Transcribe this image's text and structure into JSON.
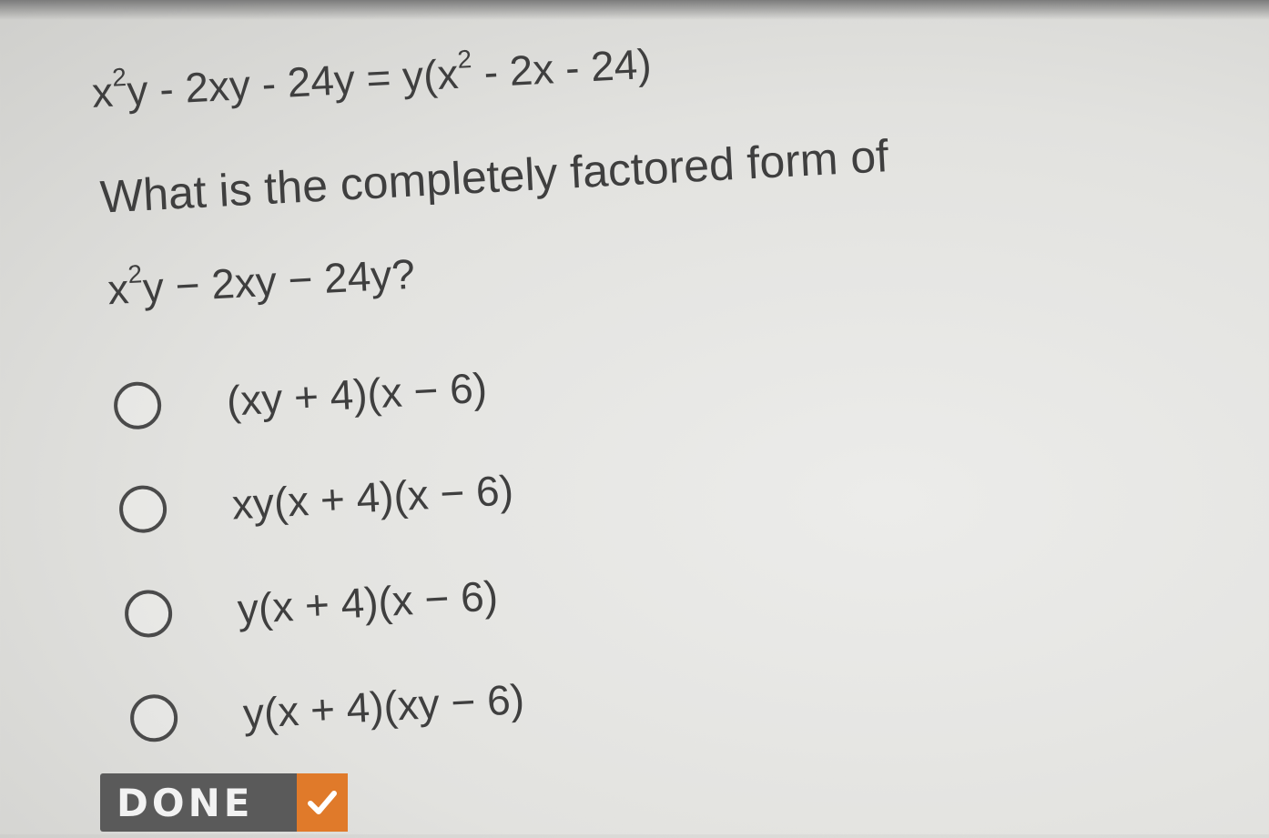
{
  "prompt_equation": {
    "parts": [
      "x",
      "2",
      "y - 2xy - 24y = y(x",
      "2",
      " - 2x - 24)"
    ]
  },
  "question": {
    "text": "What is the completely factored form of",
    "expression_parts": [
      "x",
      "2",
      "y − 2xy − 24y?"
    ]
  },
  "choices": [
    {
      "label": "(xy + 4)(x − 6)"
    },
    {
      "label": "xy(x + 4)(x − 6)"
    },
    {
      "label": "y(x + 4)(x − 6)"
    },
    {
      "label": "y(x + 4)(xy − 6)"
    }
  ],
  "done_button": {
    "label": "DONE",
    "icon": "check-icon",
    "accent_color": "#e07a2a"
  }
}
